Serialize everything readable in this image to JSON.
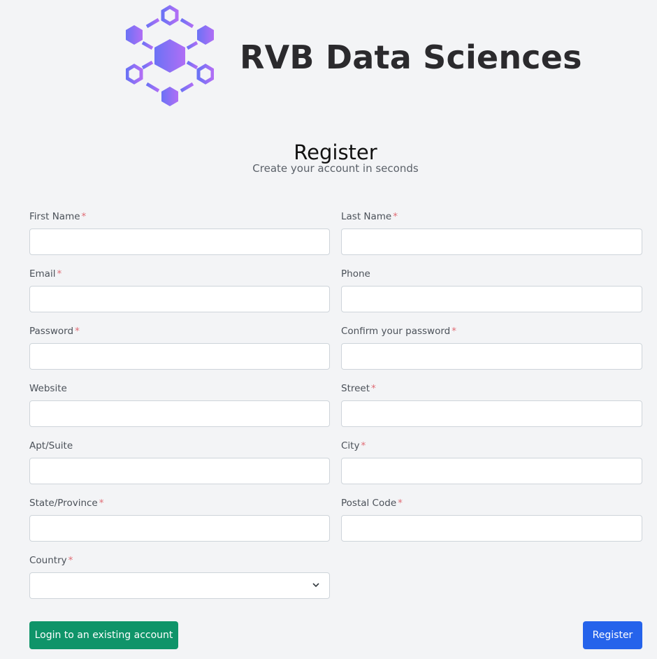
{
  "brand": {
    "name": "RVB Data Sciences",
    "logo_icon": "hexagon-network-icon",
    "colors": {
      "logo_start": "#6b72f5",
      "logo_end": "#b06ef5"
    }
  },
  "header": {
    "title": "Register",
    "subtitle": "Create your account in seconds"
  },
  "form": {
    "required_marker": "*",
    "fields": {
      "first_name": {
        "label": "First Name",
        "value": "",
        "placeholder": "",
        "required": true
      },
      "last_name": {
        "label": "Last Name",
        "value": "",
        "placeholder": "",
        "required": true
      },
      "email": {
        "label": "Email",
        "value": "",
        "placeholder": "",
        "required": true
      },
      "phone": {
        "label": "Phone",
        "value": "",
        "placeholder": "",
        "required": false
      },
      "password": {
        "label": "Password",
        "value": "",
        "placeholder": "",
        "required": true
      },
      "confirm_password": {
        "label": "Confirm your password",
        "value": "",
        "placeholder": "",
        "required": true
      },
      "website": {
        "label": "Website",
        "value": "",
        "placeholder": "",
        "required": false
      },
      "street": {
        "label": "Street",
        "value": "",
        "placeholder": "",
        "required": true
      },
      "apt_suite": {
        "label": "Apt/Suite",
        "value": "",
        "placeholder": "",
        "required": false
      },
      "city": {
        "label": "City",
        "value": "",
        "placeholder": "",
        "required": true
      },
      "state_province": {
        "label": "State/Province",
        "value": "",
        "placeholder": "",
        "required": true
      },
      "postal_code": {
        "label": "Postal Code",
        "value": "",
        "placeholder": "",
        "required": true
      },
      "country": {
        "label": "Country",
        "selected": "",
        "required": true,
        "icon": "chevron-down-icon"
      }
    }
  },
  "actions": {
    "login_label": "Login to an existing account",
    "register_label": "Register",
    "colors": {
      "login": "#0f9469",
      "register": "#2563eb"
    }
  }
}
